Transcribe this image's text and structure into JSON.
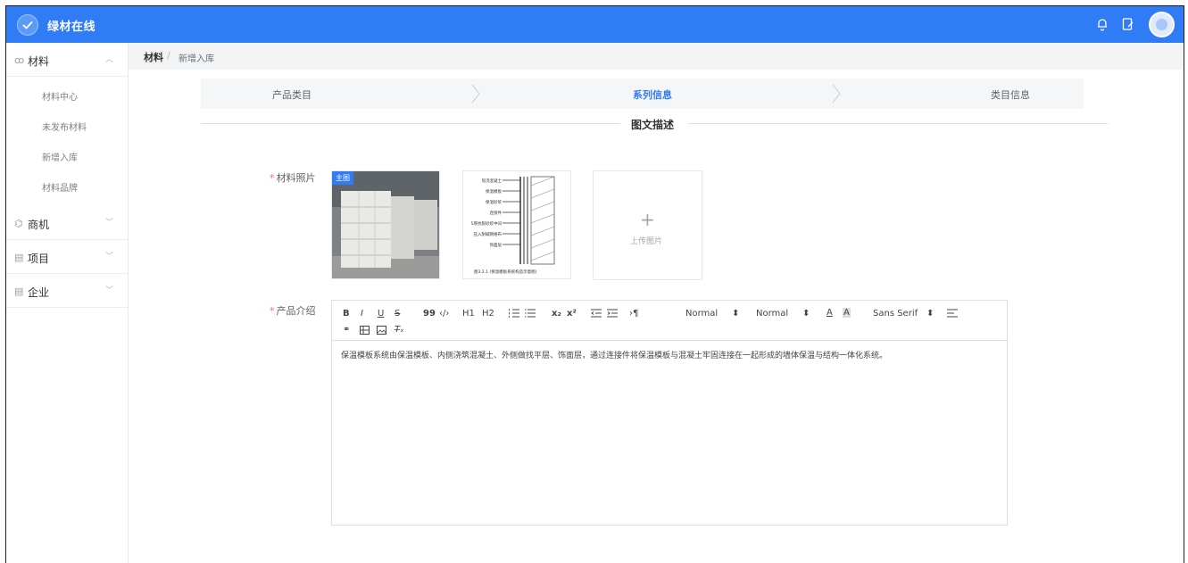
{
  "app": {
    "title": "绿材在线",
    "accent_color": "#2f7cf6",
    "logo_icon": "check-circle-icon",
    "top_icons": [
      "bell-icon",
      "edit-note-icon"
    ]
  },
  "sidebar": {
    "groups": [
      {
        "label": "材料",
        "icon": "link-icon",
        "expanded": true,
        "items": [
          "材料中心",
          "未发布材料",
          "新增入库",
          "材料品牌"
        ]
      },
      {
        "label": "商机",
        "icon": "opportunity-icon",
        "expanded": false
      },
      {
        "label": "项目",
        "icon": "project-icon",
        "expanded": false
      },
      {
        "label": "企业",
        "icon": "enterprise-icon",
        "expanded": false
      }
    ]
  },
  "breadcrumb": {
    "root": "材料",
    "separator": "/",
    "current": "新增入库"
  },
  "steps": {
    "items": [
      "产品类目",
      "系列信息",
      "类目信息"
    ],
    "active_index": 1
  },
  "section": {
    "title": "图文描述"
  },
  "form": {
    "photos_label": "材料照片",
    "main_badge": "主图",
    "upload_label": "上传图片",
    "intro_label": "产品介绍",
    "intro_text": "保温模板系统由保温模板、内侧浇筑混凝土、外侧做找平层、饰面层，通过连接件将保温模板与混凝土牢固连接在一起形成的墙体保温与结构一体化系统。"
  },
  "diagram": {
    "labels": [
      "现浇混凝土",
      "保温模板",
      "保温砂浆",
      "连接件",
      "5厚抗裂砂浆中间",
      "压入耐碱网格布",
      "饰面层"
    ],
    "caption": "图3.2.1 (保温模板系统构造示意图)"
  },
  "editor_toolbar": {
    "buttons": [
      "B",
      "I",
      "U",
      "S",
      "99",
      "‹/›",
      "H1",
      "H2",
      "ordered-list",
      "bullet-list",
      "x₂",
      "x²",
      "outdent",
      "indent",
      "›¶"
    ],
    "size_select": "Normal",
    "header_select": "Normal",
    "font_select": "Sans Serif",
    "row2": [
      "link-icon",
      "video-icon",
      "image-icon",
      "clear-format-icon"
    ]
  }
}
